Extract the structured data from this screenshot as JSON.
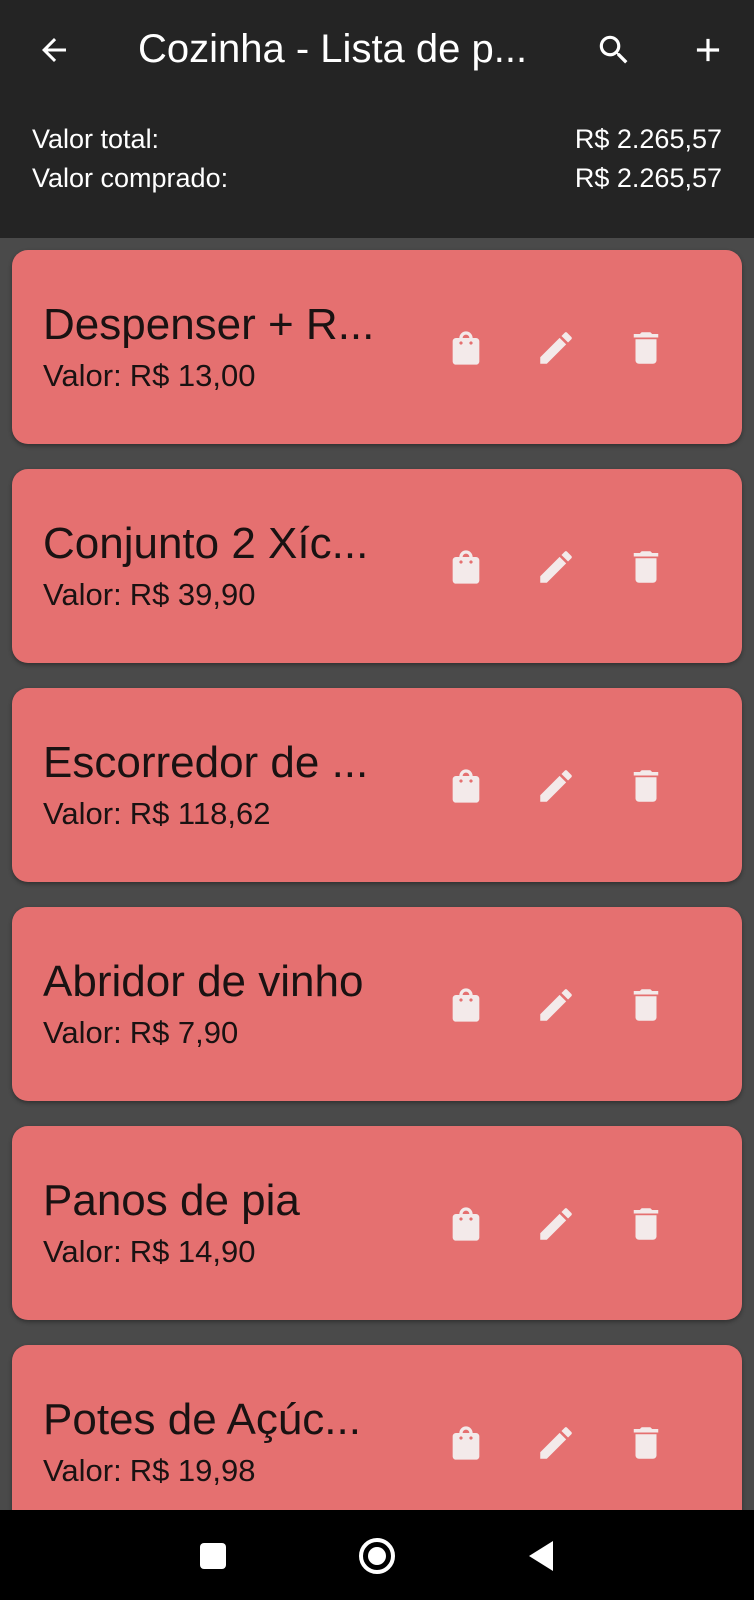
{
  "app_bar": {
    "title": "Cozinha - Lista de p...",
    "icons": {
      "back": "arrow-back-icon",
      "search": "search-icon",
      "add": "plus-icon"
    }
  },
  "summary": {
    "total_label": "Valor total:",
    "total_value": "R$ 2.265,57",
    "bought_label": "Valor comprado:",
    "bought_value": "R$ 2.265,57"
  },
  "price_prefix": "Valor:",
  "items": [
    {
      "name": "Despenser + R...",
      "price": "R$ 13,00"
    },
    {
      "name": "Conjunto 2 Xíc...",
      "price": "R$ 39,90"
    },
    {
      "name": "Escorredor de ...",
      "price": "R$ 118,62"
    },
    {
      "name": "Abridor de vinho",
      "price": "R$ 7,90"
    },
    {
      "name": "Panos de pia",
      "price": "R$ 14,90"
    },
    {
      "name": "Potes de Açúc...",
      "price": "R$ 19,98"
    }
  ],
  "item_icons": {
    "bag": "shopping-bag-icon",
    "edit": "pencil-icon",
    "delete": "trash-icon"
  },
  "colors": {
    "card": "#e57070",
    "app_bar": "#242424",
    "background": "#4a4a4a",
    "icon": "#f3eaea"
  },
  "nav_icons": [
    "recent-apps-icon",
    "home-icon",
    "back-triangle-icon"
  ]
}
